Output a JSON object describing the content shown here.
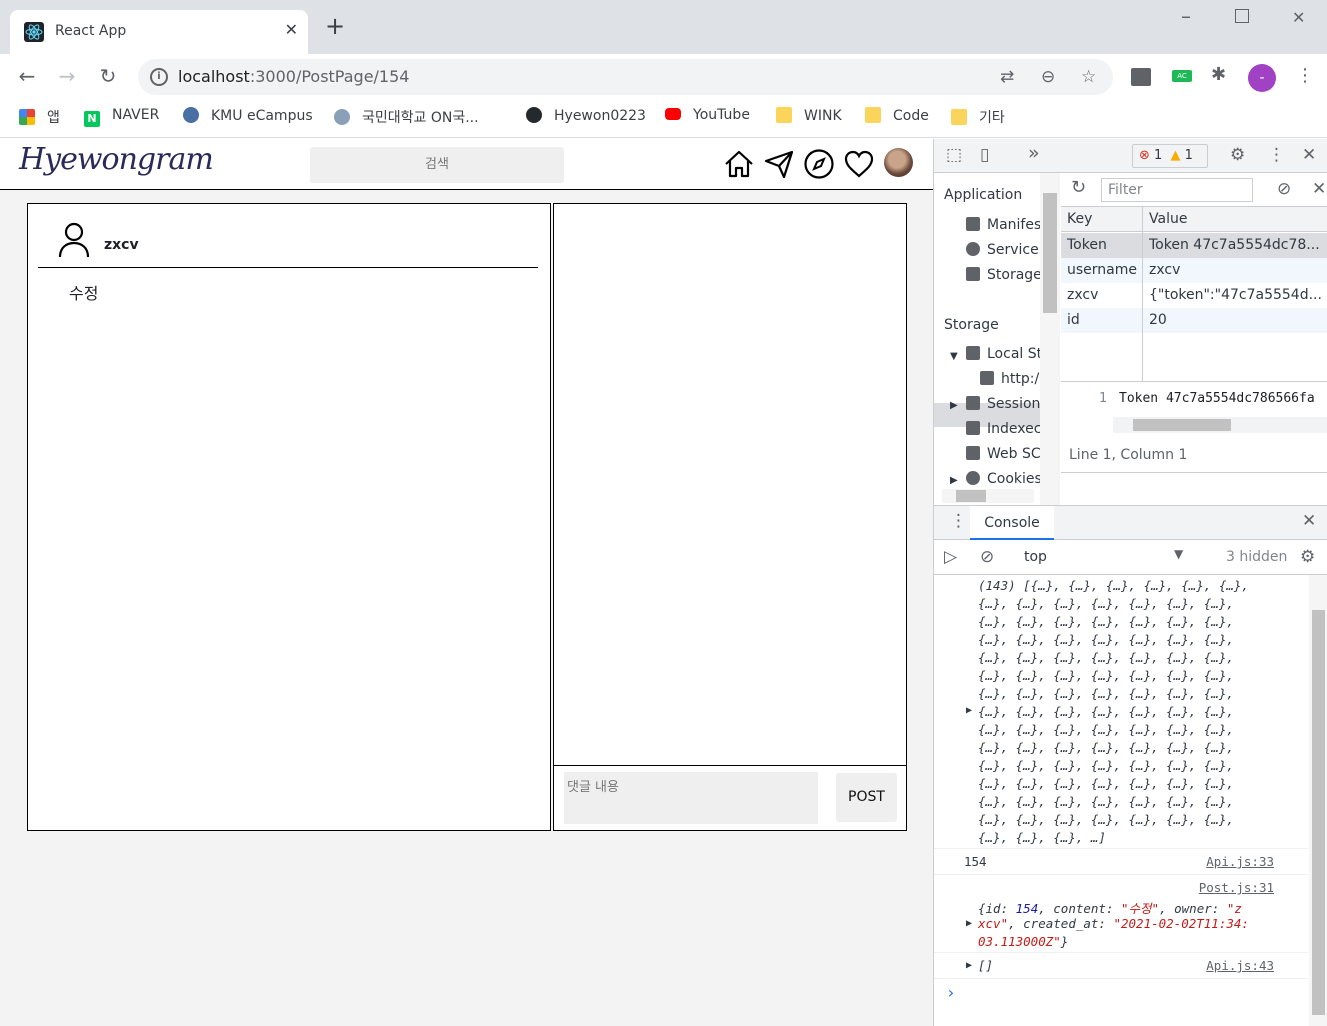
{
  "browser": {
    "tab_title": "React App",
    "url_host": "localhost",
    "url_rest": ":3000/PostPage/154",
    "bookmarks": [
      {
        "label": "앱",
        "color": "#ea4335"
      },
      {
        "label": "NAVER",
        "color": "#03c75a"
      },
      {
        "label": "KMU eCampus",
        "color": "#4a6fa5"
      },
      {
        "label": "국민대학교 ON국...",
        "color": "#8aa0b8"
      },
      {
        "label": "Hyewon0223",
        "color": "#24292e"
      },
      {
        "label": "YouTube",
        "color": "#ff0000"
      },
      {
        "label": "WINK",
        "color": "#fbd45b"
      },
      {
        "label": "Code",
        "color": "#fbd45b"
      },
      {
        "label": "기타",
        "color": "#fbd45b"
      }
    ]
  },
  "app": {
    "logo": "Hyewongram",
    "search_placeholder": "검색",
    "post": {
      "username": "zxcv",
      "content": "수정"
    },
    "comment_placeholder": "댓글 내용",
    "post_button": "POST"
  },
  "devtools": {
    "error_count": "1",
    "warning_count": "1",
    "application_heading": "Application",
    "app_items": [
      "Manifes",
      "Service",
      "Storage"
    ],
    "storage_heading": "Storage",
    "storage_items": [
      "Local St",
      "http:/",
      "Session",
      "Indexec",
      "Web SC",
      "Cookies"
    ],
    "filter_placeholder": "Filter",
    "table_headers": {
      "key": "Key",
      "value": "Value"
    },
    "rows": [
      {
        "key": "Token",
        "value": "Token 47c7a5554dc78..."
      },
      {
        "key": "username",
        "value": "zxcv"
      },
      {
        "key": "zxcv",
        "value": "{\"token\":\"47c7a5554d..."
      },
      {
        "key": "id",
        "value": "20"
      }
    ],
    "preview_line_number": "1",
    "preview_text": "Token 47c7a5554dc786566fa",
    "preview_status": "Line 1, Column 1",
    "console_tab": "Console",
    "context": "top",
    "hidden": "3 hidden",
    "console_array_lines": [
      "(143) [{…}, {…}, {…}, {…}, {…}, {…},",
      "{…}, {…}, {…}, {…}, {…}, {…}, {…},",
      "{…}, {…}, {…}, {…}, {…}, {…}, {…},",
      "{…}, {…}, {…}, {…}, {…}, {…}, {…},",
      "{…}, {…}, {…}, {…}, {…}, {…}, {…},",
      "{…}, {…}, {…}, {…}, {…}, {…}, {…},",
      "{…}, {…}, {…}, {…}, {…}, {…}, {…},",
      "{…}, {…}, {…}, {…}, {…}, {…}, {…},",
      "{…}, {…}, {…}, {…}, {…}, {…}, {…},",
      "{…}, {…}, {…}, {…}, {…}, {…}, {…},",
      "{…}, {…}, {…}, {…}, {…}, {…}, {…},",
      "{…}, {…}, {…}, {…}, {…}, {…}, {…},",
      "{…}, {…}, {…}, {…}, {…}, {…}, {…},",
      "{…}, {…}, {…}, {…}, {…}, {…}, {…},",
      "{…}, {…}, {…}, …]"
    ],
    "log_154": "154",
    "src_api33": "Api.js:33",
    "src_post31": "Post.js:31",
    "obj_line1_a": "{id: ",
    "obj_id": "154",
    "obj_line1_b": ", content: ",
    "obj_content": "\"수정\"",
    "obj_line1_c": ", owner: ",
    "obj_owner1": "\"z",
    "obj_owner2": "xcv\"",
    "obj_line2_b": ", created_at: ",
    "obj_created1": "\"2021-02-02T11:34:",
    "obj_created2": "03.113000Z\"",
    "obj_line3_end": "}",
    "empty_array": "[]",
    "src_api43": "Api.js:43",
    "prompt": "›"
  }
}
